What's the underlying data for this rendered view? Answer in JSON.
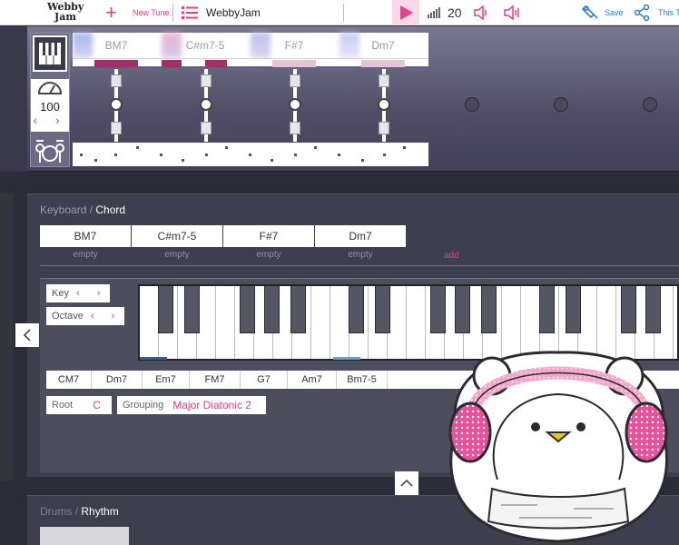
{
  "app": {
    "logo_line1": "Webby",
    "logo_line2": "Jam"
  },
  "toolbar": {
    "new_tune_label": "New Tune",
    "tune_title": "WebbyJam",
    "tempo": "20",
    "save_label": "Save",
    "share_label": "This T",
    "accent_color": "#e83d8b"
  },
  "instrument": {
    "tempo_value": "100"
  },
  "song": {
    "chords": [
      "BM7",
      "C#m7-5",
      "F#7",
      "Dm7"
    ]
  },
  "keyboard_panel": {
    "section_label": "Keyboard",
    "title": "Chord",
    "chord_tabs": [
      "BM7",
      "C#m7-5",
      "F#7",
      "Dm7"
    ],
    "empty_labels": [
      "empty",
      "empty",
      "empty",
      "empty"
    ],
    "add_label": "add",
    "key_label": "Key",
    "octave_label": "Octave",
    "diatonic_chords": [
      "CM7",
      "Dm7",
      "Em7",
      "FM7",
      "G7",
      "Am7",
      "Bm7-5"
    ],
    "root_label": "Root",
    "root_value": "C",
    "grouping_label": "Grouping",
    "grouping_value": "Major Diatonic 2"
  },
  "drums_panel": {
    "section_label": "Drums",
    "title": "Rhythm"
  }
}
